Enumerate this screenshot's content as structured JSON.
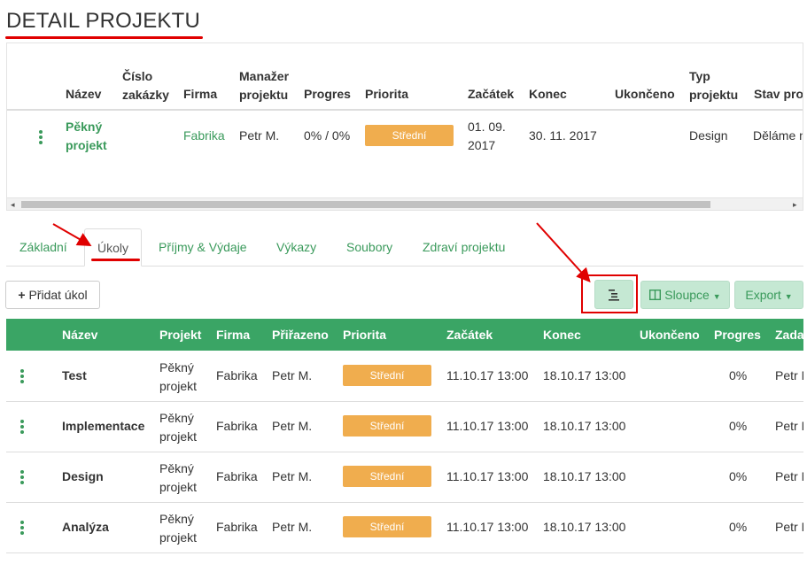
{
  "page": {
    "title": "DETAIL PROJEKTU"
  },
  "project_table": {
    "headers": {
      "name": "Název",
      "order_no_1": "Číslo",
      "order_no_2": "zakázky",
      "company": "Firma",
      "manager_1": "Manažer",
      "manager_2": "projektu",
      "progress": "Progres",
      "priority": "Priorita",
      "start": "Začátek",
      "end": "Konec",
      "finished": "Ukončeno",
      "type_1": "Typ",
      "type_2": "projektu",
      "state": "Stav projektu"
    },
    "row": {
      "name_1": "Pěkný",
      "name_2": "projekt",
      "company": "Fabrika",
      "manager": "Petr M.",
      "progress": "0% / 0%",
      "priority": "Střední",
      "start_1": "01. 09.",
      "start_2": "2017",
      "end": "30. 11. 2017",
      "type": "Design",
      "state": "Děláme na tom"
    }
  },
  "tabs": [
    {
      "label": "Základní"
    },
    {
      "label": "Úkoly",
      "active": true
    },
    {
      "label": "Příjmy & Výdaje"
    },
    {
      "label": "Výkazy"
    },
    {
      "label": "Soubory"
    },
    {
      "label": "Zdraví projektu"
    }
  ],
  "toolbar": {
    "add_task": "Přidat úkol",
    "columns": "Sloupce",
    "export": "Export"
  },
  "tasks_table": {
    "headers": {
      "name": "Název",
      "project": "Projekt",
      "company": "Firma",
      "assigned": "Přiřazeno",
      "priority": "Priorita",
      "start": "Začátek",
      "end": "Konec",
      "finished": "Ukončeno",
      "progress": "Progres",
      "assigner": "Zadavatel"
    },
    "rows": [
      {
        "name": "Test",
        "project_1": "Pěkný",
        "project_2": "projekt",
        "company": "Fabrika",
        "assigned": "Petr M.",
        "priority": "Střední",
        "start": "11.10.17 13:00",
        "end": "18.10.17 13:00",
        "progress": "0%",
        "assigner": "Petr M."
      },
      {
        "name": "Implementace",
        "project_1": "Pěkný",
        "project_2": "projekt",
        "company": "Fabrika",
        "assigned": "Petr M.",
        "priority": "Střední",
        "start": "11.10.17 13:00",
        "end": "18.10.17 13:00",
        "progress": "0%",
        "assigner": "Petr M."
      },
      {
        "name": "Design",
        "project_1": "Pěkný",
        "project_2": "projekt",
        "company": "Fabrika",
        "assigned": "Petr M.",
        "priority": "Střední",
        "start": "11.10.17 13:00",
        "end": "18.10.17 13:00",
        "progress": "0%",
        "assigner": "Petr M."
      },
      {
        "name": "Analýza",
        "project_1": "Pěkný",
        "project_2": "projekt",
        "company": "Fabrika",
        "assigned": "Petr M.",
        "priority": "Střední",
        "start": "11.10.17 13:00",
        "end": "18.10.17 13:00",
        "progress": "0%",
        "assigner": "Petr M."
      }
    ]
  },
  "colors": {
    "brand_green": "#3aa565",
    "link_green": "#3a9a5b",
    "priority_orange": "#f0ad4e",
    "annotation_red": "#e00000"
  },
  "icons": [
    "vertical-dots-icon",
    "plus-icon",
    "outline-list-icon",
    "columns-icon",
    "caret-down-icon",
    "scroll-left-arrow-icon",
    "scroll-right-arrow-icon"
  ]
}
